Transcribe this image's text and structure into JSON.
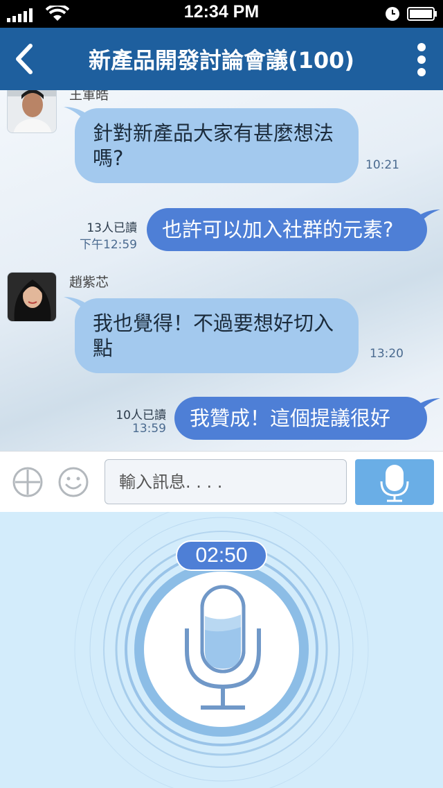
{
  "status_bar": {
    "time": "12:34 PM"
  },
  "header": {
    "title": "新產品開發討論會議(100)"
  },
  "messages": [
    {
      "sender": "王軍皓",
      "text": "針對新產品大家有甚麼想法嗎?",
      "time": "10:21"
    },
    {
      "read_count": "13人已讀",
      "time": "下午12:59",
      "text": "也許可以加入社群的元素?"
    },
    {
      "sender": "趙紫芯",
      "text": "我也覺得！不過要想好切入點",
      "time": "13:20"
    },
    {
      "read_count": "10人已讀",
      "time": "13:59",
      "text": "我贊成！這個提議很好"
    }
  ],
  "input_bar": {
    "placeholder": "輸入訊息. . . ."
  },
  "recording": {
    "timer": "02:50"
  },
  "colors": {
    "header": "#1e5f9e",
    "outgoing_bubble": "#4e7fd6",
    "incoming_bubble": "#a3c9ee",
    "record_panel": "#d3ecfb"
  },
  "icons": [
    "signal-icon",
    "wifi-icon",
    "clock-icon",
    "battery-icon",
    "back-arrow-icon",
    "more-vertical-icon",
    "plus-circle-icon",
    "smiley-icon",
    "microphone-icon"
  ]
}
